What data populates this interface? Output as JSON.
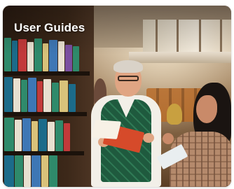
{
  "card": {
    "title": "User Guides"
  },
  "image": {
    "icon": "library-photo"
  },
  "colors": {
    "title_text": "#ffffff",
    "vest": "#1f5a3e",
    "held_book": "#d64a2a",
    "bookshelf": "#3c2819"
  }
}
